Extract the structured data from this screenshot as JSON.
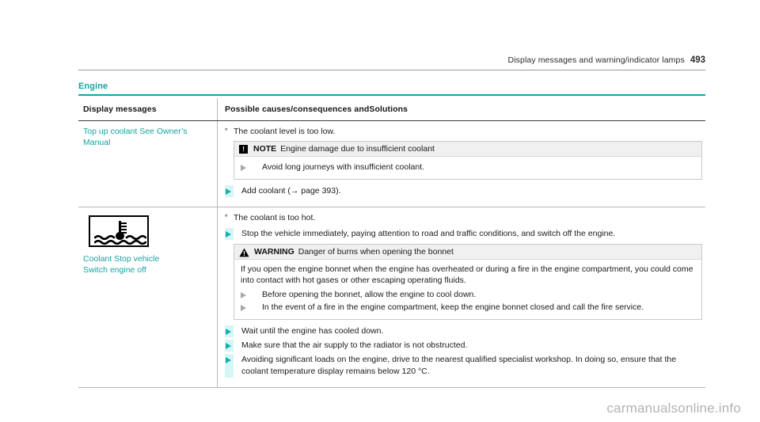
{
  "header": {
    "title": "Display messages and warning/indicator lamps",
    "page_number": "493"
  },
  "section": {
    "title": "Engine"
  },
  "table": {
    "columns": {
      "left": "Display messages",
      "right_before_marker": "Possible causes/consequences and",
      "right_after_marker": "Solutions"
    },
    "rows": [
      {
        "message": "Top up coolant See Owner’s Manual",
        "cause": "The coolant level is too low.",
        "note": {
          "icon": "exclamation-square-icon",
          "label": "NOTE",
          "title": "Engine damage due to insufficient coolant",
          "bullets": [
            "Avoid long journeys with insufficient coolant."
          ]
        },
        "solutions": [
          "Add coolant (→ page 393)."
        ]
      },
      {
        "icon_name": "coolant-temperature-warning-icon",
        "message_line_1": "Coolant Stop vehicle",
        "message_line_2": "Switch engine off",
        "cause": "The coolant is too hot.",
        "solutions_before_warning": [
          "Stop the vehicle immediately, paying attention to road and traffic conditions, and switch off the engine."
        ],
        "warning": {
          "icon": "warning-triangle-icon",
          "label": "WARNING",
          "title": "Danger of burns when opening the bonnet",
          "paragraph": "If you open the engine bonnet when the engine has overheated or during a fire in the engine compartment, you could come into contact with hot gases or other escaping operating fluids.",
          "bullets": [
            "Before opening the bonnet, allow the engine to cool down.",
            "In the event of a fire in the engine compartment, keep the engine bonnet closed and call the fire service."
          ]
        },
        "solutions_after_warning": [
          "Wait until the engine has cooled down.",
          "Make sure that the air supply to the radiator is not obstructed.",
          "Avoiding significant loads on the engine, drive to the nearest qualified specialist workshop. In doing so, ensure that the coolant temperature display remains below 120 °C."
        ]
      }
    ]
  },
  "note_icon_glyph": "!",
  "watermark": "carmanualsonline.info",
  "colors": {
    "accent_teal": "#17a2a2",
    "bullet_teal": "#0fb0b0",
    "bullet_band": "#d6f5f5",
    "box_header_gray": "#f0f0f0",
    "watermark_gray": "#b2b2b6"
  }
}
